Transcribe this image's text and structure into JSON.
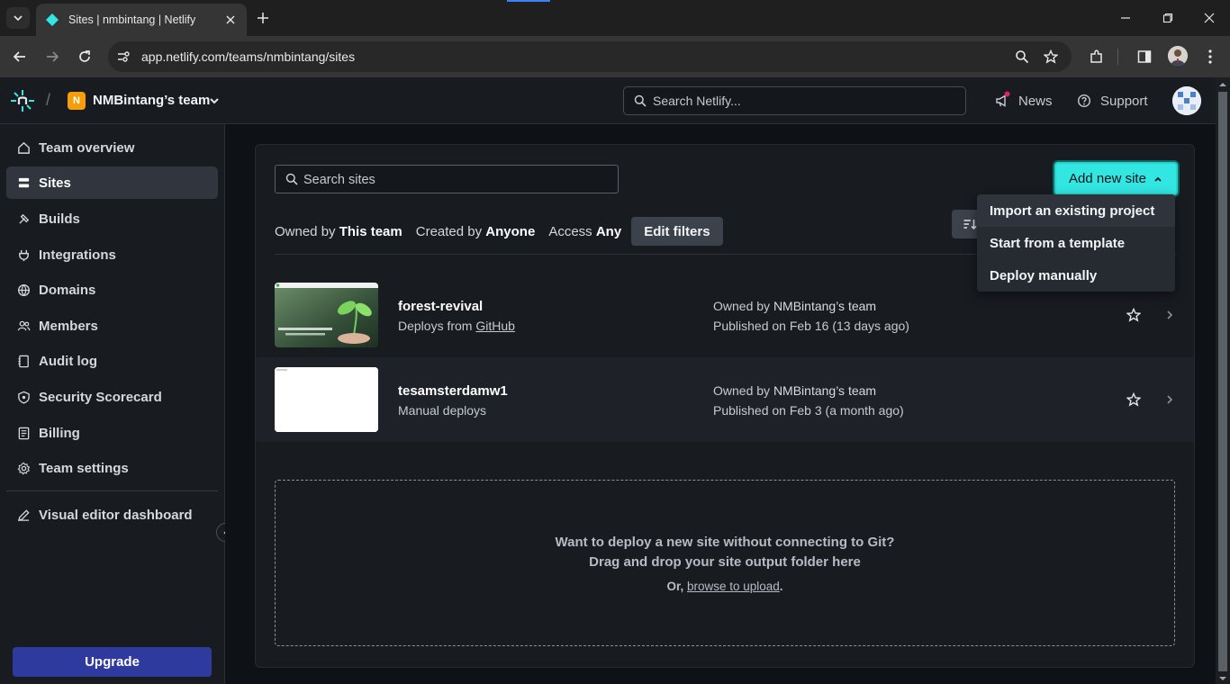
{
  "browser": {
    "tab_title": "Sites | nmbintang | Netlify",
    "url": "app.netlify.com/teams/nmbintang/sites"
  },
  "header": {
    "team_initial": "N",
    "team_name": "NMBintang’s team",
    "search_placeholder": "Search Netlify...",
    "news_label": "News",
    "support_label": "Support"
  },
  "sidebar": {
    "items": [
      {
        "label": "Team overview",
        "icon": "home-icon"
      },
      {
        "label": "Sites",
        "icon": "sites-icon"
      },
      {
        "label": "Builds",
        "icon": "hammer-icon"
      },
      {
        "label": "Integrations",
        "icon": "plug-icon"
      },
      {
        "label": "Domains",
        "icon": "globe-icon"
      },
      {
        "label": "Members",
        "icon": "users-icon"
      },
      {
        "label": "Audit log",
        "icon": "notebook-icon"
      },
      {
        "label": "Security Scorecard",
        "icon": "shield-icon"
      },
      {
        "label": "Billing",
        "icon": "receipt-icon"
      },
      {
        "label": "Team settings",
        "icon": "gear-icon"
      },
      {
        "label": "Visual editor dashboard",
        "icon": "pencil-icon"
      }
    ],
    "active": "Sites",
    "upgrade_label": "Upgrade"
  },
  "main": {
    "search_placeholder": "Search sites",
    "add_site_label": "Add new site",
    "filters": [
      {
        "prefix": "Owned by",
        "value": "This team"
      },
      {
        "prefix": "Created by",
        "value": "Anyone"
      },
      {
        "prefix": "Access",
        "value": "Any"
      }
    ],
    "edit_filters_label": "Edit filters",
    "menu": [
      "Import an existing project",
      "Start from a template",
      "Deploy manually"
    ],
    "sites": [
      {
        "name": "forest-revival",
        "deploy_prefix": "Deploys from",
        "deploy_link": "GitHub",
        "owner_prefix": "Owned by",
        "owner": "NMBintang’s team",
        "published": "Published on Feb 16 (13 days ago)"
      },
      {
        "name": "tesamsterdamw1",
        "deploy_prefix": "Manual deploys",
        "deploy_link": "",
        "owner_prefix": "Owned by",
        "owner": "NMBintang’s team",
        "published": "Published on Feb 3 (a month ago)"
      }
    ],
    "dropzone": {
      "line1": "Want to deploy a new site without connecting to Git?",
      "line2": "Drag and drop your site output folder here",
      "or_prefix": "Or,",
      "or_link": "browse to upload",
      "or_suffix": "."
    }
  },
  "colors": {
    "accent": "#32e6e2",
    "upgrade": "#2e3a9e",
    "team_avatar": "#f59e0b"
  }
}
